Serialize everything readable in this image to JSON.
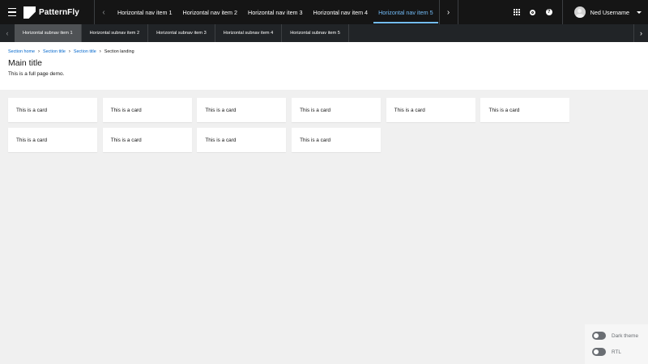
{
  "masthead": {
    "brand": "PatternFly",
    "nav_items": [
      {
        "label": "Horizontal nav item 1",
        "current": false
      },
      {
        "label": "Horizontal nav item 2",
        "current": false
      },
      {
        "label": "Horizontal nav item 3",
        "current": false
      },
      {
        "label": "Horizontal nav item 4",
        "current": false
      },
      {
        "label": "Horizontal nav item 5",
        "current": true
      }
    ],
    "user_name": "Ned Username",
    "help_glyph": "?",
    "scroll_left_glyph": "‹",
    "scroll_right_glyph": "›"
  },
  "subnav": {
    "items": [
      {
        "label": "Horizontal subnav item 1",
        "current": true
      },
      {
        "label": "Horizontal subnav item 2",
        "current": false
      },
      {
        "label": "Horizontal subnav item 3",
        "current": false
      },
      {
        "label": "Horizontal subnav item 4",
        "current": false
      },
      {
        "label": "Horizontal subnav item 5",
        "current": false
      }
    ],
    "scroll_left_glyph": "‹",
    "scroll_right_glyph": "›"
  },
  "breadcrumb": {
    "items": [
      "Section home",
      "Section title",
      "Section title"
    ],
    "current": "Section landing",
    "separator": "›"
  },
  "page": {
    "title": "Main title",
    "description": "This is a full page demo."
  },
  "cards": [
    "This is a card",
    "This is a card",
    "This is a card",
    "This is a card",
    "This is a card",
    "This is a card",
    "This is a card",
    "This is a card",
    "This is a card",
    "This is a card"
  ],
  "theme_switcher": {
    "dark_theme_label": "Dark theme",
    "rtl_label": "RTL"
  },
  "colors": {
    "masthead_bg": "#151515",
    "subnav_bg": "#212427",
    "subnav_current_bg": "#4f5255",
    "nav_current": "#73bcf7",
    "link": "#0066cc",
    "page_bg": "#f0f0f0"
  },
  "icons": {
    "menu": "hamburger-menu-icon",
    "apps": "app-launcher-grid-icon",
    "settings": "cog-icon",
    "help": "question-circle-icon",
    "user_dropdown": "caret-down-icon"
  }
}
